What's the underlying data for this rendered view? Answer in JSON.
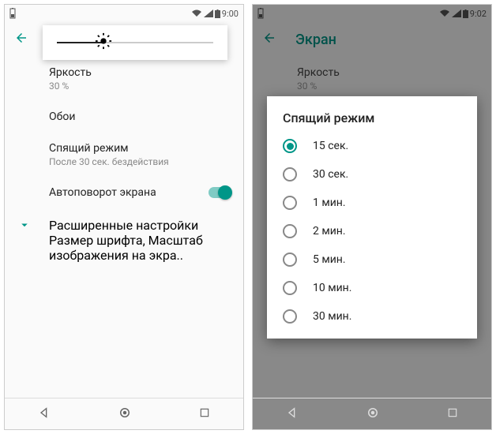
{
  "left": {
    "status": {
      "time": "9:00"
    },
    "brightness_pct": 30,
    "items": {
      "brightness": {
        "title": "Яркость",
        "sub": "30 %"
      },
      "wallpaper": {
        "title": "Обои"
      },
      "sleep": {
        "title": "Спящий режим",
        "sub": "После 30 сек. бездействия"
      },
      "autorotate": {
        "title": "Автоповорот экрана"
      },
      "advanced": {
        "title": "Расширенные настройки",
        "sub": "Размер шрифта, Масштаб изображения на экра.."
      }
    }
  },
  "right": {
    "status": {
      "time": "9:02"
    },
    "screen_title": "Экран",
    "items": {
      "brightness": {
        "title": "Яркость",
        "sub": "30 %"
      }
    },
    "dialog": {
      "title": "Спящий режим",
      "options": [
        {
          "label": "15 сек.",
          "selected": true
        },
        {
          "label": "30 сек.",
          "selected": false
        },
        {
          "label": "1 мин.",
          "selected": false
        },
        {
          "label": "2 мин.",
          "selected": false
        },
        {
          "label": "5 мин.",
          "selected": false
        },
        {
          "label": "10 мин.",
          "selected": false
        },
        {
          "label": "30 мин.",
          "selected": false
        }
      ]
    }
  }
}
